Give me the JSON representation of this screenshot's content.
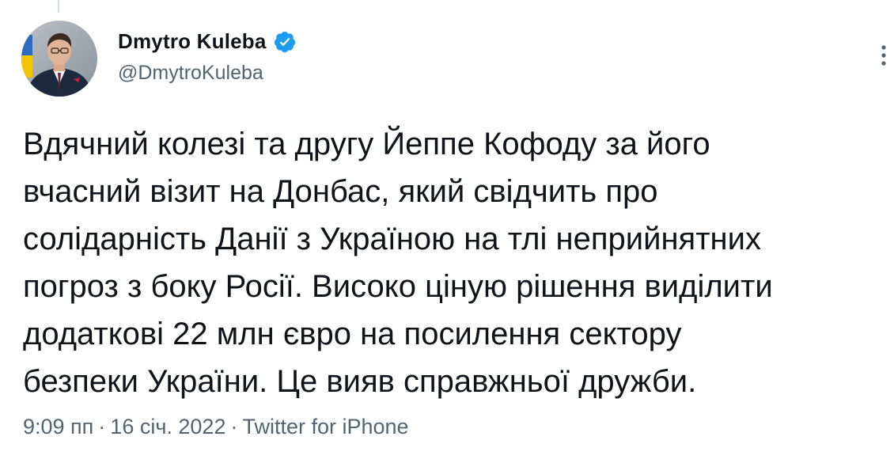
{
  "author": {
    "display_name": "Dmytro Kuleba",
    "handle": "@DmytroKuleba",
    "verified": true
  },
  "tweet": {
    "lines": [
      "Вдячний колезі та другу Йеппе Кофоду за його",
      "вчасний візит на Донбас, який свідчить про",
      "солідарність Данії з Україною на тлі неприйнятних",
      "погроз з боку Росії. Високо ціную рішення виділити",
      "додаткові 22 млн євро на посилення сектору",
      "безпеки України. Це вияв справжньої дружби."
    ]
  },
  "meta": {
    "time": "9:09 пп",
    "separator": "·",
    "date": "16 січ. 2022",
    "source": "Twitter for iPhone"
  },
  "icons": {
    "verified": "verified-badge-icon",
    "more": "more-options-icon"
  },
  "colors": {
    "verified_blue": "#1d9bf0",
    "secondary_text": "#536471",
    "primary_text": "#0f1419"
  }
}
